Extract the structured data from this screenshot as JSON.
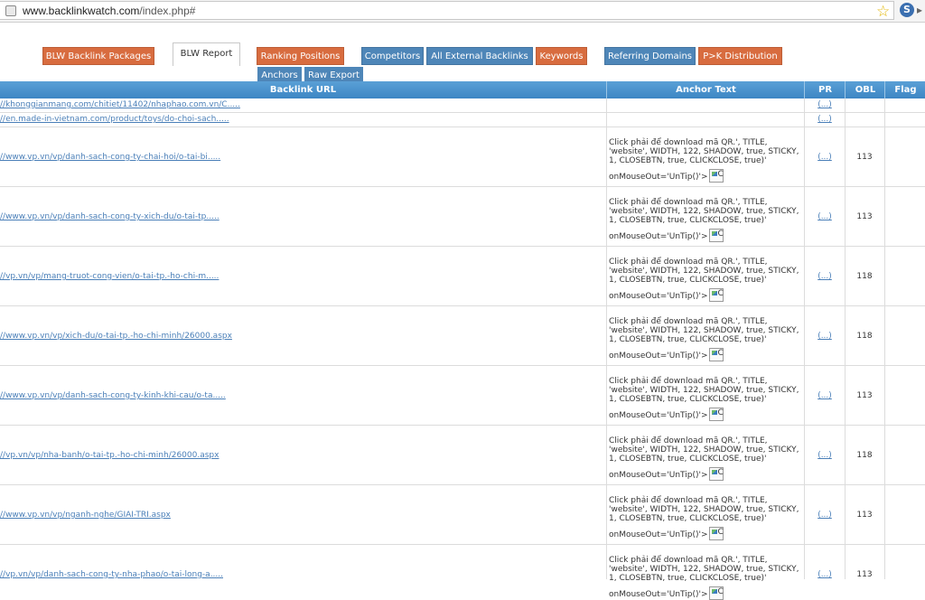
{
  "browser": {
    "url_domain": "www.backlinkwatch.com",
    "url_path": "/index.php#"
  },
  "tabs": [
    {
      "label": "BLW Backlink Packages"
    },
    {
      "label": "BLW Report"
    },
    {
      "label": "Ranking Positions"
    },
    {
      "label": "Competitors"
    },
    {
      "label": "All External Backlinks"
    },
    {
      "label": "Keywords"
    },
    {
      "label": "Referring Domains"
    },
    {
      "label": "P>K Distribution"
    }
  ],
  "subtabs": [
    {
      "label": "Anchors"
    },
    {
      "label": "Raw Export"
    }
  ],
  "table": {
    "headers": {
      "url": "Backlink URL",
      "anchor": "Anchor Text",
      "pr": "PR",
      "obl": "OBL",
      "flag": "Flag"
    },
    "rows": [
      {
        "url": "//khonggianmang.com/chitiet/11402/nhaphao.com.vn/C.....",
        "anchor": "",
        "tip": "",
        "pr": "(...)",
        "obl": ""
      },
      {
        "url": "//en.made-in-vietnam.com/product/toys/do-choi-sach.....",
        "anchor": "",
        "tip": "",
        "pr": "(...)",
        "obl": ""
      },
      {
        "url": "//www.vp.vn/vp/danh-sach-cong-ty-chai-hoi/o-tai-bi.....",
        "anchor": "Click phải để download mã QR.', TITLE, 'website', WIDTH, 122, SHADOW, true, STICKY, 1, CLOSEBTN, true, CLICKCLOSE, true)'",
        "tip": "onMouseOut='UnTip()'>",
        "pr": "(...)",
        "obl": "113"
      },
      {
        "url": "//www.vp.vn/vp/danh-sach-cong-ty-xich-du/o-tai-tp.....",
        "anchor": "Click phải để download mã QR.', TITLE, 'website', WIDTH, 122, SHADOW, true, STICKY, 1, CLOSEBTN, true, CLICKCLOSE, true)'",
        "tip": "onMouseOut='UnTip()'>",
        "pr": "(...)",
        "obl": "113"
      },
      {
        "url": "//vp.vn/vp/mang-truot-cong-vien/o-tai-tp.-ho-chi-m.....",
        "anchor": "Click phải để download mã QR.', TITLE, 'website', WIDTH, 122, SHADOW, true, STICKY, 1, CLOSEBTN, true, CLICKCLOSE, true)'",
        "tip": "onMouseOut='UnTip()'>",
        "pr": "(...)",
        "obl": "118"
      },
      {
        "url": "//www.vp.vn/vp/xich-du/o-tai-tp.-ho-chi-minh/26000.aspx",
        "anchor": "Click phải để download mã QR.', TITLE, 'website', WIDTH, 122, SHADOW, true, STICKY, 1, CLOSEBTN, true, CLICKCLOSE, true)'",
        "tip": "onMouseOut='UnTip()'>",
        "pr": "(...)",
        "obl": "118"
      },
      {
        "url": "//www.vp.vn/vp/danh-sach-cong-ty-kinh-khi-cau/o-ta.....",
        "anchor": "Click phải để download mã QR.', TITLE, 'website', WIDTH, 122, SHADOW, true, STICKY, 1, CLOSEBTN, true, CLICKCLOSE, true)'",
        "tip": "onMouseOut='UnTip()'>",
        "pr": "(...)",
        "obl": "113"
      },
      {
        "url": "//vp.vn/vp/nha-banh/o-tai-tp.-ho-chi-minh/26000.aspx",
        "anchor": "Click phải để download mã QR.', TITLE, 'website', WIDTH, 122, SHADOW, true, STICKY, 1, CLOSEBTN, true, CLICKCLOSE, true)'",
        "tip": "onMouseOut='UnTip()'>",
        "pr": "(...)",
        "obl": "118"
      },
      {
        "url": "//www.vp.vn/vp/nganh-nghe/GIAI-TRI.aspx",
        "anchor": "Click phải để download mã QR.', TITLE, 'website', WIDTH, 122, SHADOW, true, STICKY, 1, CLOSEBTN, true, CLICKCLOSE, true)'",
        "tip": "onMouseOut='UnTip()'>",
        "pr": "(...)",
        "obl": "113"
      },
      {
        "url": "//vp.vn/vp/danh-sach-cong-ty-nha-phao/o-tai-long-a.....",
        "anchor": "Click phải để download mã QR.', TITLE, 'website', WIDTH, 122, SHADOW, true, STICKY, 1, CLOSEBTN, true, CLICKCLOSE, true)'",
        "tip": "onMouseOut='UnTip()'>",
        "pr": "(...)",
        "obl": "113"
      }
    ]
  },
  "colors": {
    "tab_orange": "#d86c3f",
    "tab_blue": "#4e86b8",
    "header_blue": "#3d86c4",
    "link_blue": "#4a7fb8"
  },
  "icons": [
    "globe-icon",
    "star-icon",
    "extension-icon",
    "broken-image-icon"
  ]
}
